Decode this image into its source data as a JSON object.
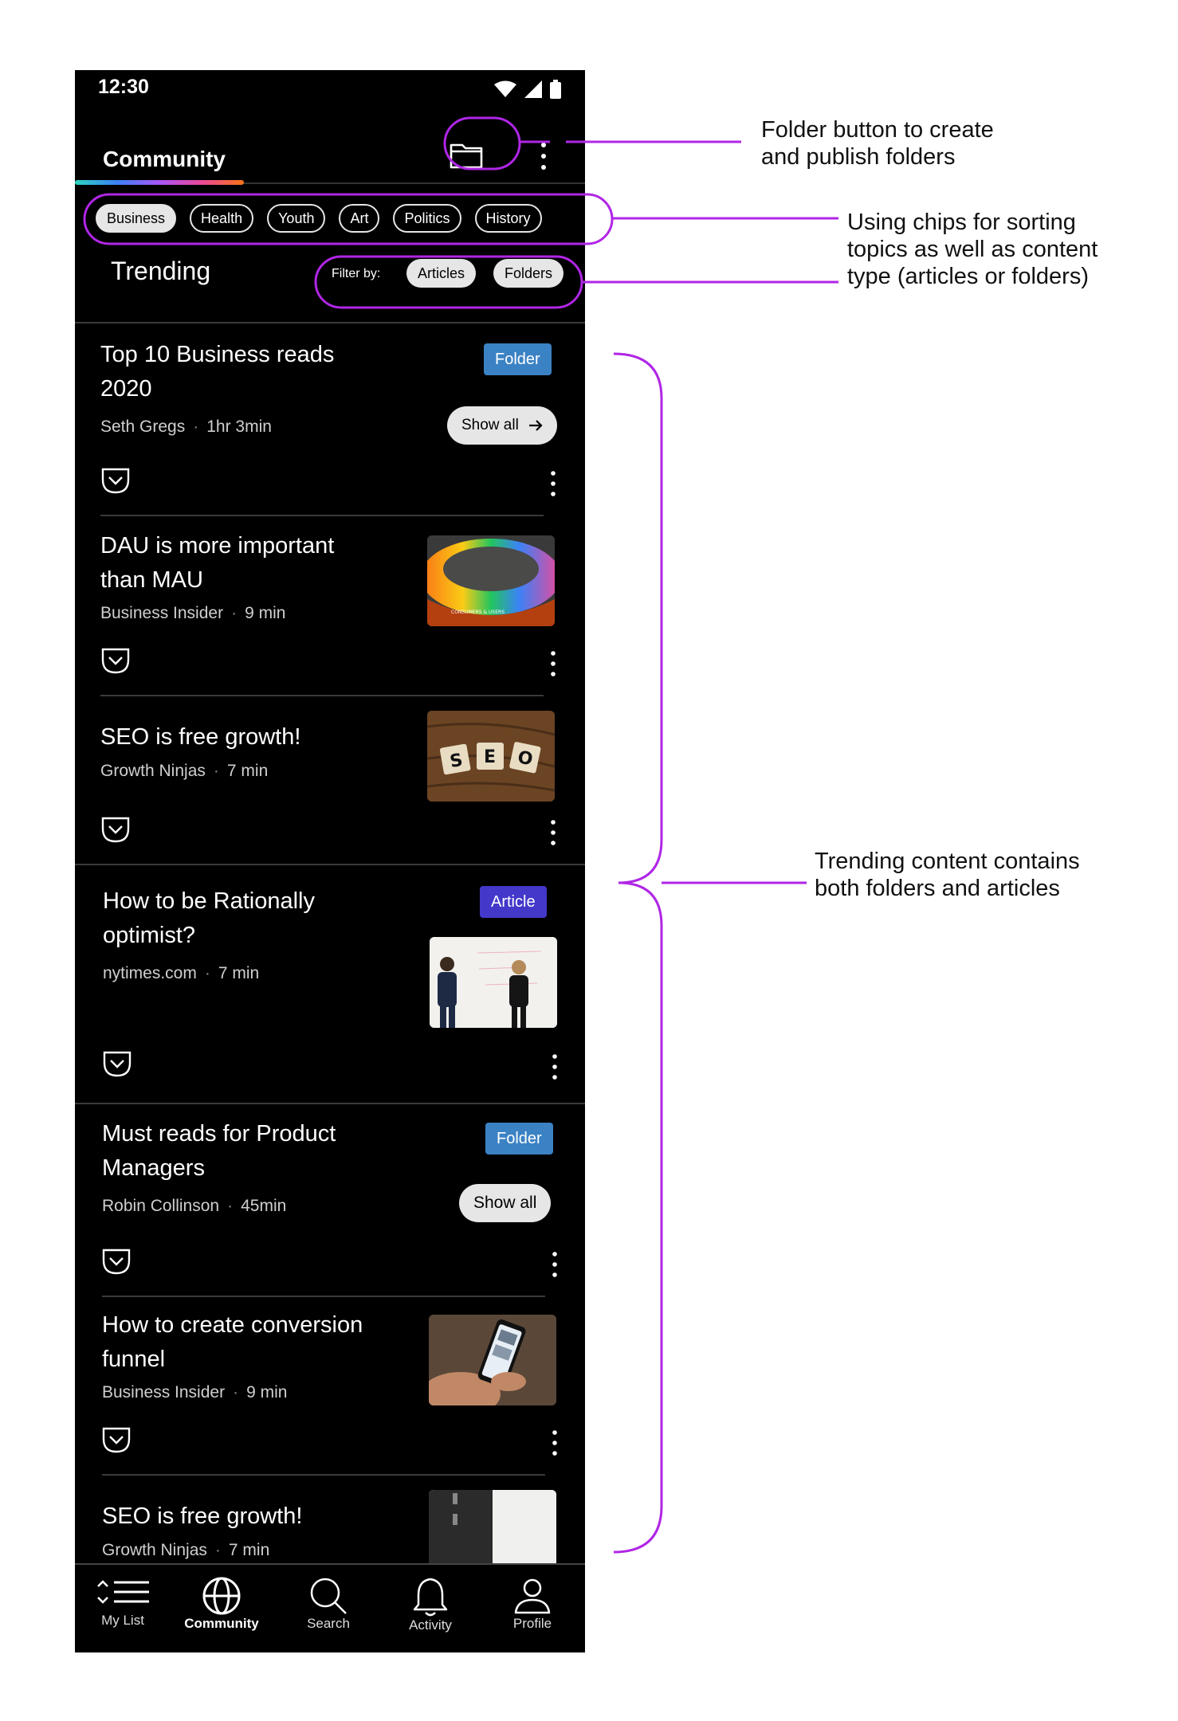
{
  "status": {
    "time": "12:30"
  },
  "appbar": {
    "title": "Community"
  },
  "chips": [
    "Business",
    "Health",
    "Youth",
    "Art",
    "Politics",
    "History"
  ],
  "trending": {
    "title": "Trending",
    "filter_label": "Filter by:",
    "filter_articles": "Articles",
    "filter_folders": "Folders"
  },
  "items": [
    {
      "title": "Top 10 Business reads 2020",
      "source": "Seth Gregs",
      "duration": "1hr 3min",
      "badge": "Folder",
      "show_all": "Show all"
    },
    {
      "title": "DAU is more important than MAU",
      "source": "Business Insider",
      "duration": "9 min",
      "thumb_label": "CONSUMERS & USERS"
    },
    {
      "title": "SEO is free growth!",
      "source": "Growth Ninjas",
      "duration": "7 min",
      "tiles": [
        "S",
        "E",
        "O"
      ]
    },
    {
      "title": "How to be Rationally optimist?",
      "source": "nytimes.com",
      "duration": "7 min",
      "badge": "Article"
    },
    {
      "title": "Must reads for Product Managers",
      "source": "Robin Collinson",
      "duration": "45min",
      "badge": "Folder",
      "show_all": "Show all"
    },
    {
      "title": "How to create conversion funnel",
      "source": "Business Insider",
      "duration": "9 min"
    },
    {
      "title": "SEO is free growth!",
      "source": "Growth Ninjas",
      "duration": "7 min"
    }
  ],
  "nav": {
    "mylist": "My List",
    "community": "Community",
    "search": "Search",
    "activity": "Activity",
    "profile": "Profile"
  },
  "annotations": {
    "folder": [
      "Folder button to create",
      "and publish folders"
    ],
    "chips": [
      "Using chips for sorting",
      "topics as well as content",
      "type (articles or folders)"
    ],
    "trending": [
      "Trending content contains",
      "both folders and articles"
    ]
  },
  "colors": {
    "annotation": "#b026e6",
    "folder_badge": "#3b82c4",
    "article_badge": "#4338ca"
  }
}
